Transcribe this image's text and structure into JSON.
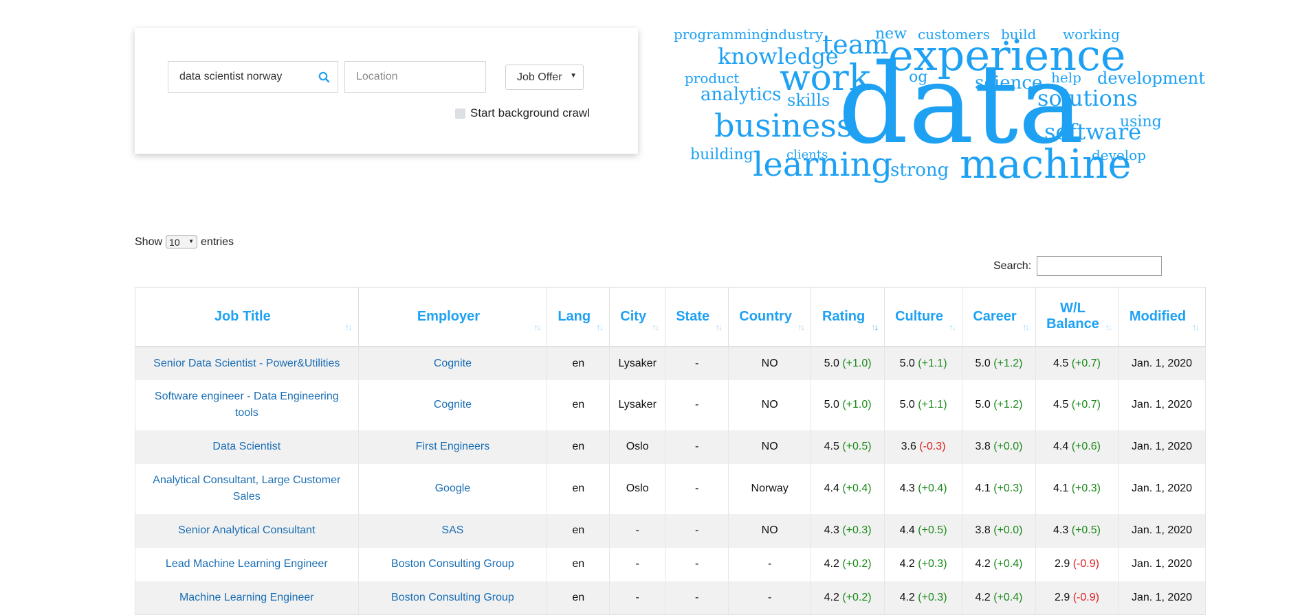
{
  "search": {
    "query": "data scientist norway",
    "location_placeholder": "Location",
    "type_selected": "Job Offer",
    "crawl_label": "Start background crawl"
  },
  "wordcloud": {
    "color": "#1ea1f3",
    "words": [
      "programming",
      "industry",
      "team",
      "new",
      "customers",
      "build",
      "working",
      "knowledge",
      "experience",
      "product",
      "work",
      "og",
      "science",
      "help",
      "development",
      "analytics",
      "skills",
      "solutions",
      "using",
      "business",
      "data",
      "software",
      "building",
      "clients",
      "learning",
      "strong",
      "machine",
      "develop"
    ]
  },
  "table_controls": {
    "show_label": "Show",
    "entries_value": "10",
    "entries_label": "entries",
    "search_label": "Search:"
  },
  "table": {
    "columns": [
      "Job Title",
      "Employer",
      "Lang",
      "City",
      "State",
      "Country",
      "Rating",
      "Culture",
      "Career",
      "W/L Balance",
      "Modified"
    ],
    "rows": [
      {
        "title": "Senior Data Scientist - Power&Utilities",
        "employer": "Cognite",
        "lang": "en",
        "city": "Lysaker",
        "state": "-",
        "country": "NO",
        "rating": "5.0",
        "rating_delta": "(+1.0)",
        "culture": "5.0",
        "culture_delta": "(+1.1)",
        "career": "5.0",
        "career_delta": "(+1.2)",
        "wl": "4.5",
        "wl_delta": "(+0.7)",
        "modified": "Jan. 1, 2020"
      },
      {
        "title": "Software engineer - Data Engineering tools",
        "employer": "Cognite",
        "lang": "en",
        "city": "Lysaker",
        "state": "-",
        "country": "NO",
        "rating": "5.0",
        "rating_delta": "(+1.0)",
        "culture": "5.0",
        "culture_delta": "(+1.1)",
        "career": "5.0",
        "career_delta": "(+1.2)",
        "wl": "4.5",
        "wl_delta": "(+0.7)",
        "modified": "Jan. 1, 2020"
      },
      {
        "title": "Data Scientist",
        "employer": "First Engineers",
        "lang": "en",
        "city": "Oslo",
        "state": "-",
        "country": "NO",
        "rating": "4.5",
        "rating_delta": "(+0.5)",
        "culture": "3.6",
        "culture_delta": "(-0.3)",
        "career": "3.8",
        "career_delta": "(+0.0)",
        "wl": "4.4",
        "wl_delta": "(+0.6)",
        "modified": "Jan. 1, 2020"
      },
      {
        "title": "Analytical Consultant, Large Customer Sales",
        "employer": "Google",
        "lang": "en",
        "city": "Oslo",
        "state": "-",
        "country": "Norway",
        "rating": "4.4",
        "rating_delta": "(+0.4)",
        "culture": "4.3",
        "culture_delta": "(+0.4)",
        "career": "4.1",
        "career_delta": "(+0.3)",
        "wl": "4.1",
        "wl_delta": "(+0.3)",
        "modified": "Jan. 1, 2020"
      },
      {
        "title": "Senior Analytical Consultant",
        "employer": "SAS",
        "lang": "en",
        "city": "-",
        "state": "-",
        "country": "NO",
        "rating": "4.3",
        "rating_delta": "(+0.3)",
        "culture": "4.4",
        "culture_delta": "(+0.5)",
        "career": "3.8",
        "career_delta": "(+0.0)",
        "wl": "4.3",
        "wl_delta": "(+0.5)",
        "modified": "Jan. 1, 2020"
      },
      {
        "title": "Lead Machine Learning Engineer",
        "employer": "Boston Consulting Group",
        "lang": "en",
        "city": "-",
        "state": "-",
        "country": "-",
        "rating": "4.2",
        "rating_delta": "(+0.2)",
        "culture": "4.2",
        "culture_delta": "(+0.3)",
        "career": "4.2",
        "career_delta": "(+0.4)",
        "wl": "2.9",
        "wl_delta": "(-0.9)",
        "modified": "Jan. 1, 2020"
      },
      {
        "title": "Machine Learning Engineer",
        "employer": "Boston Consulting Group",
        "lang": "en",
        "city": "-",
        "state": "-",
        "country": "-",
        "rating": "4.2",
        "rating_delta": "(+0.2)",
        "culture": "4.2",
        "culture_delta": "(+0.3)",
        "career": "4.2",
        "career_delta": "(+0.4)",
        "wl": "2.9",
        "wl_delta": "(-0.9)",
        "modified": "Jan. 1, 2020"
      }
    ]
  },
  "colors": {
    "accent": "#1ea1f3",
    "link": "#1a6eb4",
    "positive": "#1a8a1a",
    "negative": "#e0201f"
  }
}
